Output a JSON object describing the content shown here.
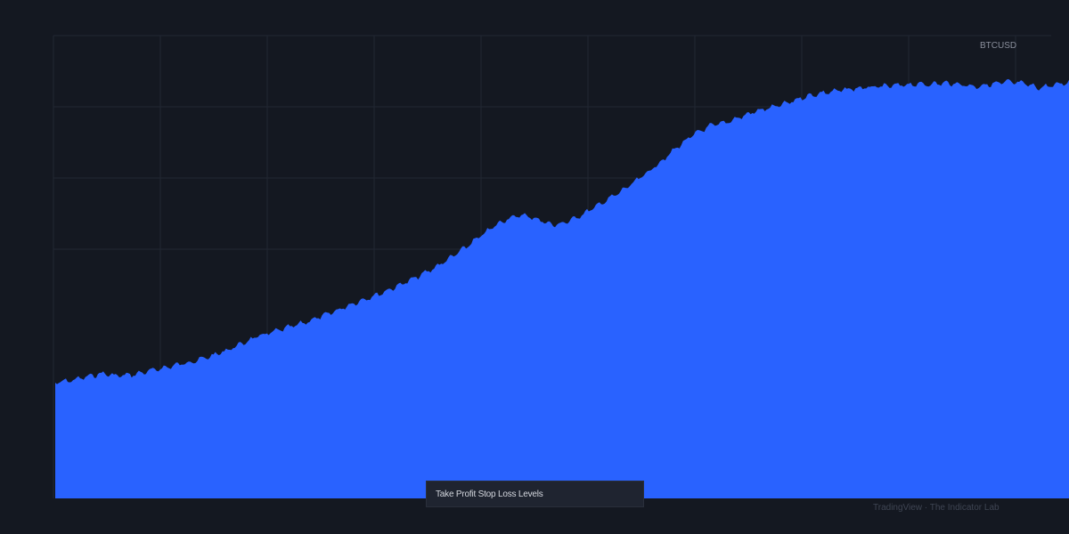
{
  "chart_data": {
    "type": "area",
    "symbol": "BTCUSD",
    "series": [
      {
        "values": [
          1.0,
          1.02,
          1.05,
          1.08,
          1.06,
          1.07,
          1.1,
          1.13,
          1.16,
          1.19,
          1.23,
          1.28,
          1.34,
          1.4,
          1.44,
          1.48,
          1.52,
          1.57,
          1.62,
          1.68,
          1.73,
          1.78,
          1.84,
          1.9,
          1.97,
          2.05,
          2.14,
          2.24,
          2.34,
          2.42,
          2.45,
          2.41,
          2.36,
          2.4,
          2.47,
          2.55,
          2.63,
          2.72,
          2.82,
          2.93,
          3.05,
          3.15,
          3.22,
          3.25,
          3.3,
          3.35,
          3.38,
          3.42,
          3.47,
          3.5,
          3.52,
          3.54,
          3.55,
          3.56,
          3.57,
          3.58,
          3.58,
          3.59,
          3.58,
          3.56,
          3.58,
          3.6,
          3.59,
          3.55,
          3.57,
          3.6
        ]
      }
    ],
    "ylim": [
      0,
      4.0
    ],
    "grid": true,
    "colors": {
      "fill": "#2962ff",
      "grid": "#222733",
      "background": "#141821"
    }
  },
  "caption": {
    "text": "Take Profit Stop Loss Levels"
  },
  "watermark": {
    "text": "TradingView · The Indicator Lab"
  }
}
